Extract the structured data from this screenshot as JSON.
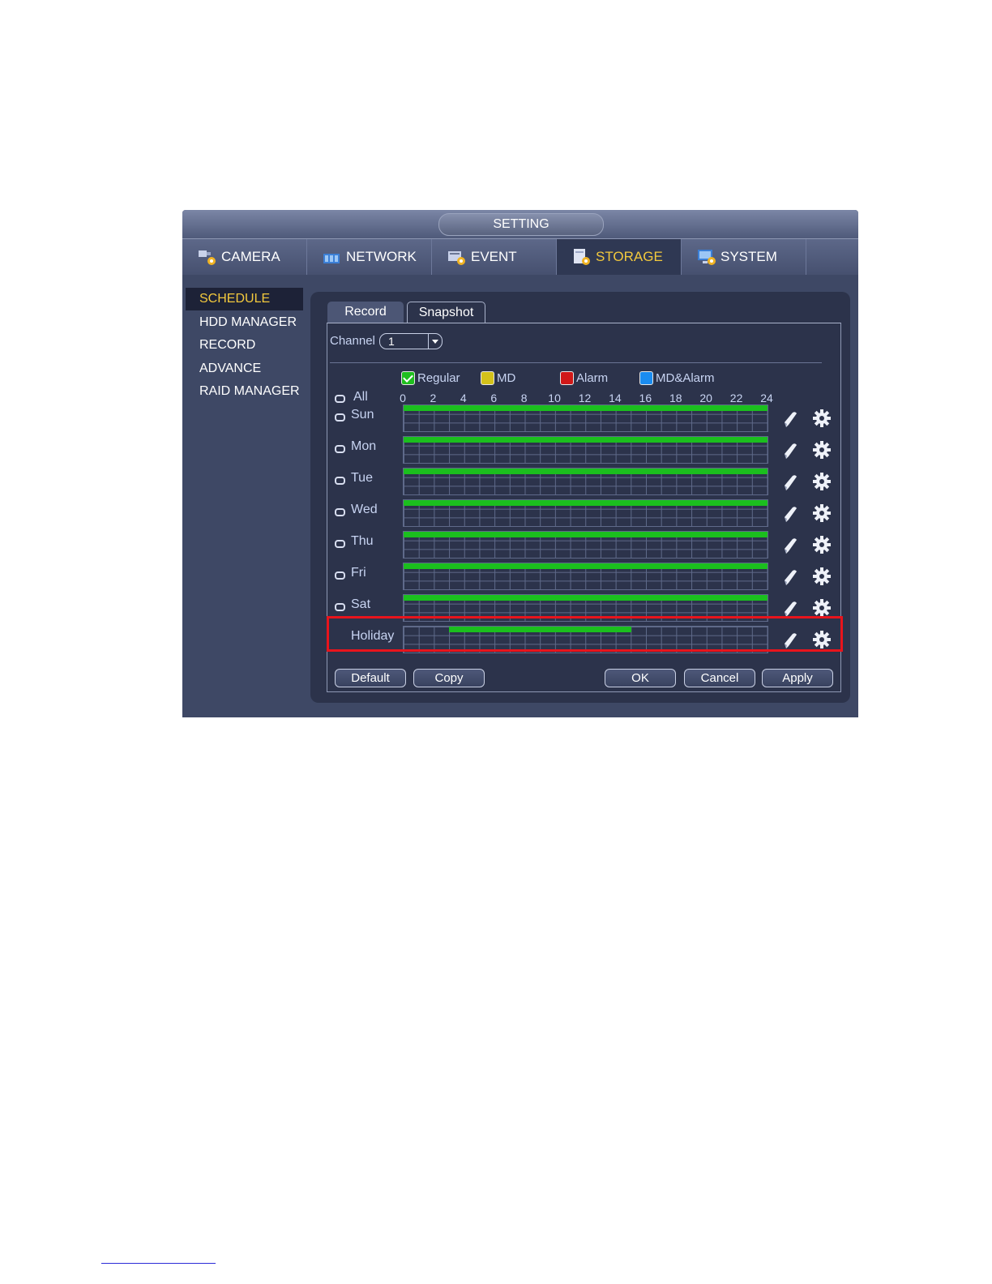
{
  "window": {
    "title": "SETTING"
  },
  "nav": [
    {
      "label": "CAMERA",
      "icon": "camera-icon",
      "active": false
    },
    {
      "label": "NETWORK",
      "icon": "network-icon",
      "active": false
    },
    {
      "label": "EVENT",
      "icon": "event-icon",
      "active": false
    },
    {
      "label": "STORAGE",
      "icon": "storage-icon",
      "active": true
    },
    {
      "label": "SYSTEM",
      "icon": "system-icon",
      "active": false
    }
  ],
  "sidebar": [
    {
      "label": "SCHEDULE",
      "active": true
    },
    {
      "label": "HDD MANAGER",
      "active": false
    },
    {
      "label": "RECORD",
      "active": false
    },
    {
      "label": "ADVANCE",
      "active": false
    },
    {
      "label": "RAID MANAGER",
      "active": false
    }
  ],
  "tabs": [
    {
      "label": "Record",
      "active": false
    },
    {
      "label": "Snapshot",
      "active": true
    }
  ],
  "channel": {
    "label": "Channel",
    "value": "1"
  },
  "legend": [
    {
      "label": "Regular",
      "color": "#1fbf1f",
      "checked": true
    },
    {
      "label": "MD",
      "color": "#d4c21a",
      "checked": false
    },
    {
      "label": "Alarm",
      "color": "#d01818",
      "checked": false
    },
    {
      "label": "MD&Alarm",
      "color": "#1a8cf0",
      "checked": false
    }
  ],
  "all_label": "All",
  "hours": [
    "0",
    "2",
    "4",
    "6",
    "8",
    "10",
    "12",
    "14",
    "16",
    "18",
    "20",
    "22",
    "24"
  ],
  "days": [
    {
      "label": "Sun",
      "segments": [
        [
          0,
          24
        ]
      ]
    },
    {
      "label": "Mon",
      "segments": [
        [
          0,
          24
        ]
      ]
    },
    {
      "label": "Tue",
      "segments": [
        [
          0,
          24
        ]
      ]
    },
    {
      "label": "Wed",
      "segments": [
        [
          0,
          24
        ]
      ]
    },
    {
      "label": "Thu",
      "segments": [
        [
          0,
          24
        ]
      ]
    },
    {
      "label": "Fri",
      "segments": [
        [
          0,
          24
        ]
      ]
    },
    {
      "label": "Sat",
      "segments": [
        [
          0,
          24
        ]
      ]
    },
    {
      "label": "Holiday",
      "segments": [
        [
          3,
          15
        ]
      ]
    }
  ],
  "buttons": {
    "default": "Default",
    "copy": "Copy",
    "ok": "OK",
    "cancel": "Cancel",
    "apply": "Apply"
  },
  "colors": {
    "segment": "#1bbf1e",
    "highlight": "#e8141c",
    "active_text": "#f3c93d"
  }
}
